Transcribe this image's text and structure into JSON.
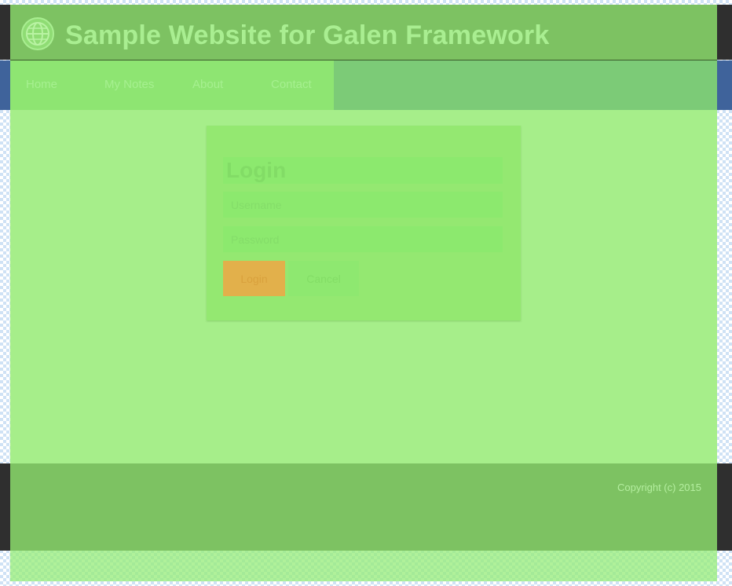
{
  "header": {
    "title": "Sample Website for Galen Framework",
    "logo_icon": "globe-icon"
  },
  "nav": {
    "items": [
      {
        "label": "Home"
      },
      {
        "label": "My Notes"
      },
      {
        "label": "About"
      },
      {
        "label": "Contact"
      }
    ]
  },
  "login": {
    "title": "Login",
    "username_placeholder": "Username",
    "password_placeholder": "Password",
    "login_label": "Login",
    "cancel_label": "Cancel"
  },
  "footer": {
    "copyright": "Copyright (c) 2015"
  },
  "colors": {
    "header_bg": "#7dc262",
    "nav_menu_bg": "#8ee572",
    "main_bg": "#a6ee8a",
    "login_button": "#e2b04b",
    "side_band_dark": "#2f2f2f",
    "nav_side_band": "#3f639b"
  }
}
